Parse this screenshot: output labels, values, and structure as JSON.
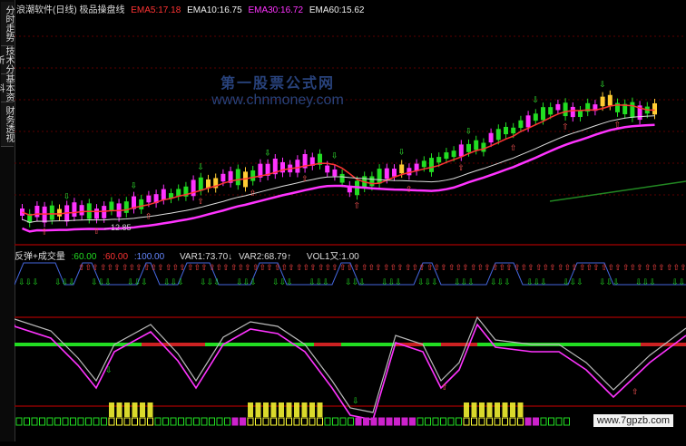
{
  "side_tabs": [
    {
      "label": "分时走势"
    },
    {
      "label": "技术分析"
    },
    {
      "label": "基本资料"
    },
    {
      "label": "财务透视"
    }
  ],
  "top_header": {
    "title": "浪潮软件(日线) 极品操盘线",
    "ema5_label": "EMA5:17.18",
    "ema10_label": "EMA10:16.75",
    "ema30_label": "EMA30:16.72",
    "ema60_label": "EMA60:15.62",
    "colors": {
      "title": "#dddddd",
      "ema5": "#ff3333",
      "ema10": "#eeeeee",
      "ema30": "#ff33ff",
      "ema60": "#eeeeee"
    }
  },
  "watermark": {
    "line1": "第一股票公式网",
    "line2": "www.chnmoney.com"
  },
  "price_low_label": "←12.85",
  "mid_header": {
    "items": [
      {
        "text": "反弹+成交量",
        "color": "#dddddd"
      },
      {
        "text": ":60.00",
        "color": "#22dd22"
      },
      {
        "text": ":60.00",
        "color": "#ff3333"
      },
      {
        "text": ":100.00",
        "color": "#6688ff"
      },
      {
        "text": "VAR1:73.70↓",
        "color": "#dddddd"
      },
      {
        "text": "VAR2:68.79↑",
        "color": "#dddddd"
      },
      {
        "text": "VOL1又:1.00",
        "color": "#dddddd"
      }
    ]
  },
  "footer": {
    "site": "www.7gpzb.com"
  },
  "colors": {
    "up": "#ff33ff",
    "down": "#22dd22",
    "flat": "#ffcc33",
    "ema5": "#ff3333",
    "ema30": "#ff33ff",
    "ema60": "#dddddd",
    "grid": "#8b0000",
    "wave": "#4466dd"
  }
}
